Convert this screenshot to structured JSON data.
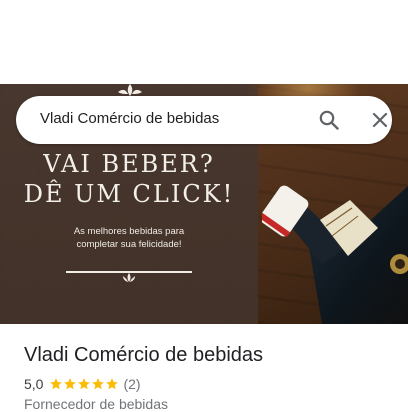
{
  "search": {
    "query": "Vladi Comércio de bebidas"
  },
  "banner": {
    "headline_line1": "VAI BEBER?",
    "headline_line2": "DÊ UM CLICK!",
    "sub_line1": "As melhores bebidas para",
    "sub_line2": "completar sua felicidade!"
  },
  "place": {
    "name": "Vladi Comércio de bebidas",
    "rating": "5,0",
    "stars": 5,
    "review_count": "(2)",
    "category": "Fornecedor de bebidas"
  },
  "icons": {
    "search": "search-icon",
    "close": "close-icon",
    "star": "star-icon"
  },
  "colors": {
    "star": "#fbbc04",
    "text_primary": "#202124",
    "text_secondary": "#70757a"
  }
}
